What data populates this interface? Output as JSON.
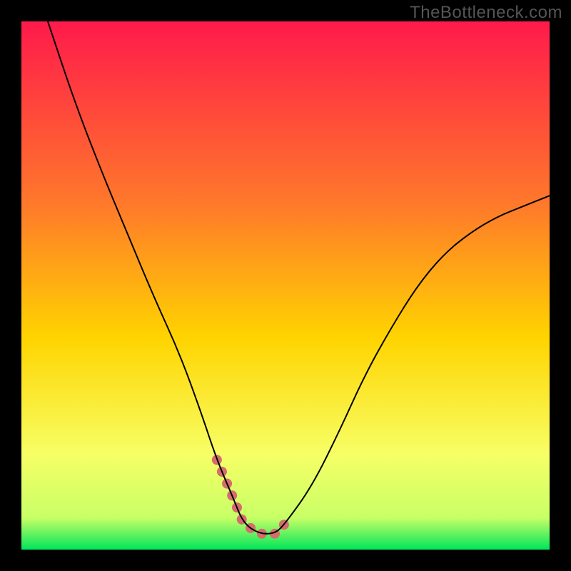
{
  "watermark": "TheBottleneck.com",
  "chart_data": {
    "type": "line",
    "title": "",
    "xlabel": "",
    "ylabel": "",
    "xlim": [
      0,
      100
    ],
    "ylim": [
      0,
      100
    ],
    "background_gradient_top": "#ff1a4b",
    "background_gradient_mid": "#ffd400",
    "background_gradient_bottom": "#00e65a",
    "series": [
      {
        "name": "curve",
        "stroke": "#000000",
        "stroke_width": 2,
        "x": [
          5,
          10,
          15,
          20,
          25,
          30,
          34,
          37,
          40,
          42,
          45,
          48,
          50,
          55,
          60,
          65,
          70,
          75,
          80,
          85,
          90,
          95,
          100
        ],
        "y": [
          100,
          85,
          72,
          60,
          48,
          37,
          26,
          17,
          10,
          5,
          3,
          3,
          5,
          12,
          22,
          33,
          42,
          50,
          56,
          60,
          63,
          65,
          67
        ]
      },
      {
        "name": "highlight",
        "stroke": "#d46d6d",
        "stroke_width": 14,
        "x": [
          37,
          40,
          42,
          45,
          48,
          50
        ],
        "y": [
          17,
          10,
          5,
          3,
          3,
          5
        ]
      }
    ],
    "annotations": []
  }
}
